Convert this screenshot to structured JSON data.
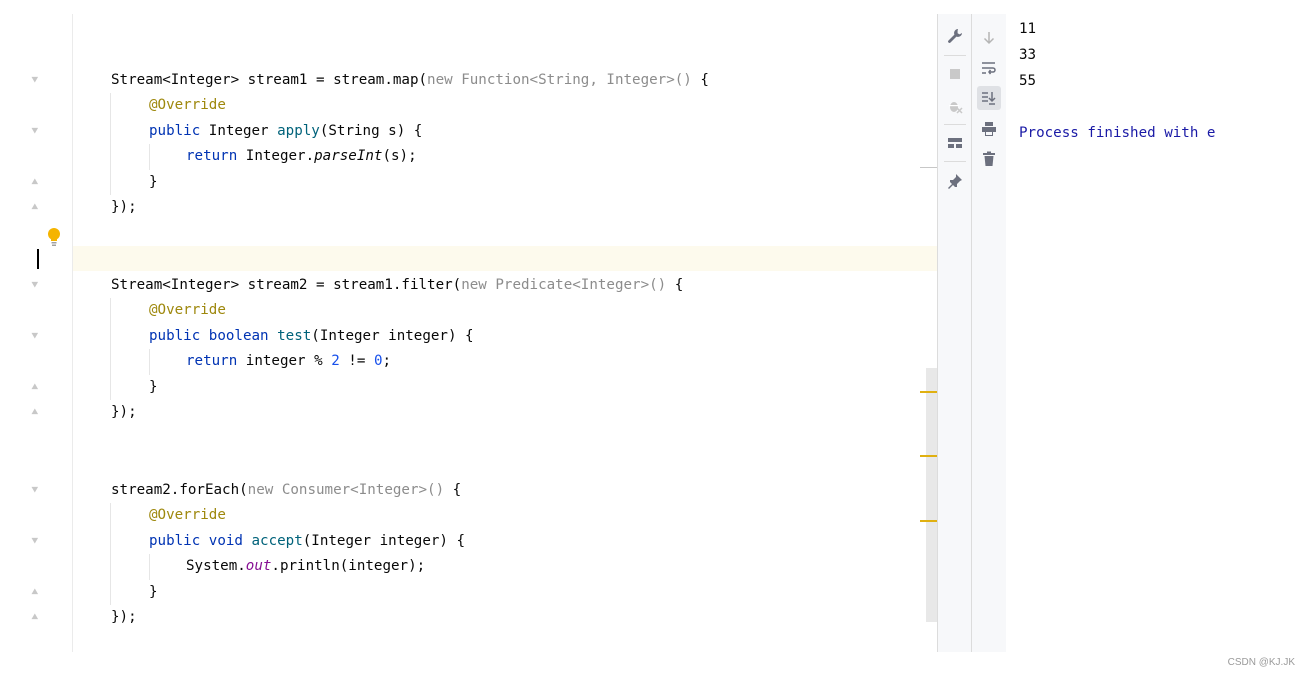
{
  "editor": {
    "lines": {
      "l1": {
        "type1": "Stream<Integer>",
        "var1": " stream1 = stream.map(",
        "new1": "new",
        "anon1": " Function<String, Integer>()",
        "brace1": " {"
      },
      "l2": {
        "ann": "@Override"
      },
      "l3": {
        "pub": "public",
        "type": " Integer ",
        "fn": "apply",
        "args": "(String s) {"
      },
      "l4": {
        "ret": "return",
        "rest1": " Integer.",
        "method": "parseInt",
        "rest2": "(s);"
      },
      "l5": {
        "text": "}"
      },
      "l6": {
        "text": "});"
      },
      "l7": {
        "type": "Stream<Integer>",
        "var": " stream2 = stream1.filter(",
        "new": "new",
        "anon": " Predicate<Integer>()",
        "brace": " {"
      },
      "l8": {
        "ann": "@Override"
      },
      "l9": {
        "pub": "public",
        "bool": " boolean ",
        "fn": "test",
        "args": "(Integer integer) {"
      },
      "l10": {
        "ret": "return",
        "rest1": " integer % ",
        "num1": "2",
        "rest2": " != ",
        "num2": "0",
        "rest3": ";"
      },
      "l11": {
        "text": "}"
      },
      "l12": {
        "text": "});"
      },
      "l13": {
        "var": "stream2.forEach(",
        "new": "new",
        "anon": " Consumer<Integer>()",
        "brace": " {"
      },
      "l14": {
        "ann": "@Override"
      },
      "l15": {
        "pub": "public",
        "void": " void ",
        "fn": "accept",
        "args": "(Integer integer) {"
      },
      "l16": {
        "sys": "System.",
        "out": "out",
        "rest": ".println(integer);"
      },
      "l17": {
        "text": "}"
      },
      "l18": {
        "text": "});"
      }
    }
  },
  "console": {
    "lines": [
      "11",
      "33",
      "55",
      "",
      "Process finished with e"
    ]
  },
  "icons": {
    "toolbar_left": [
      "wrench-icon",
      "stop-icon",
      "debug-disabled-icon",
      "layout-icon",
      "pin-icon"
    ],
    "toolbar_right": [
      "arrow-down-icon",
      "soft-wrap-icon",
      "scroll-to-end-icon",
      "print-icon",
      "trash-icon"
    ]
  },
  "watermark": "CSDN @KJ.JK"
}
